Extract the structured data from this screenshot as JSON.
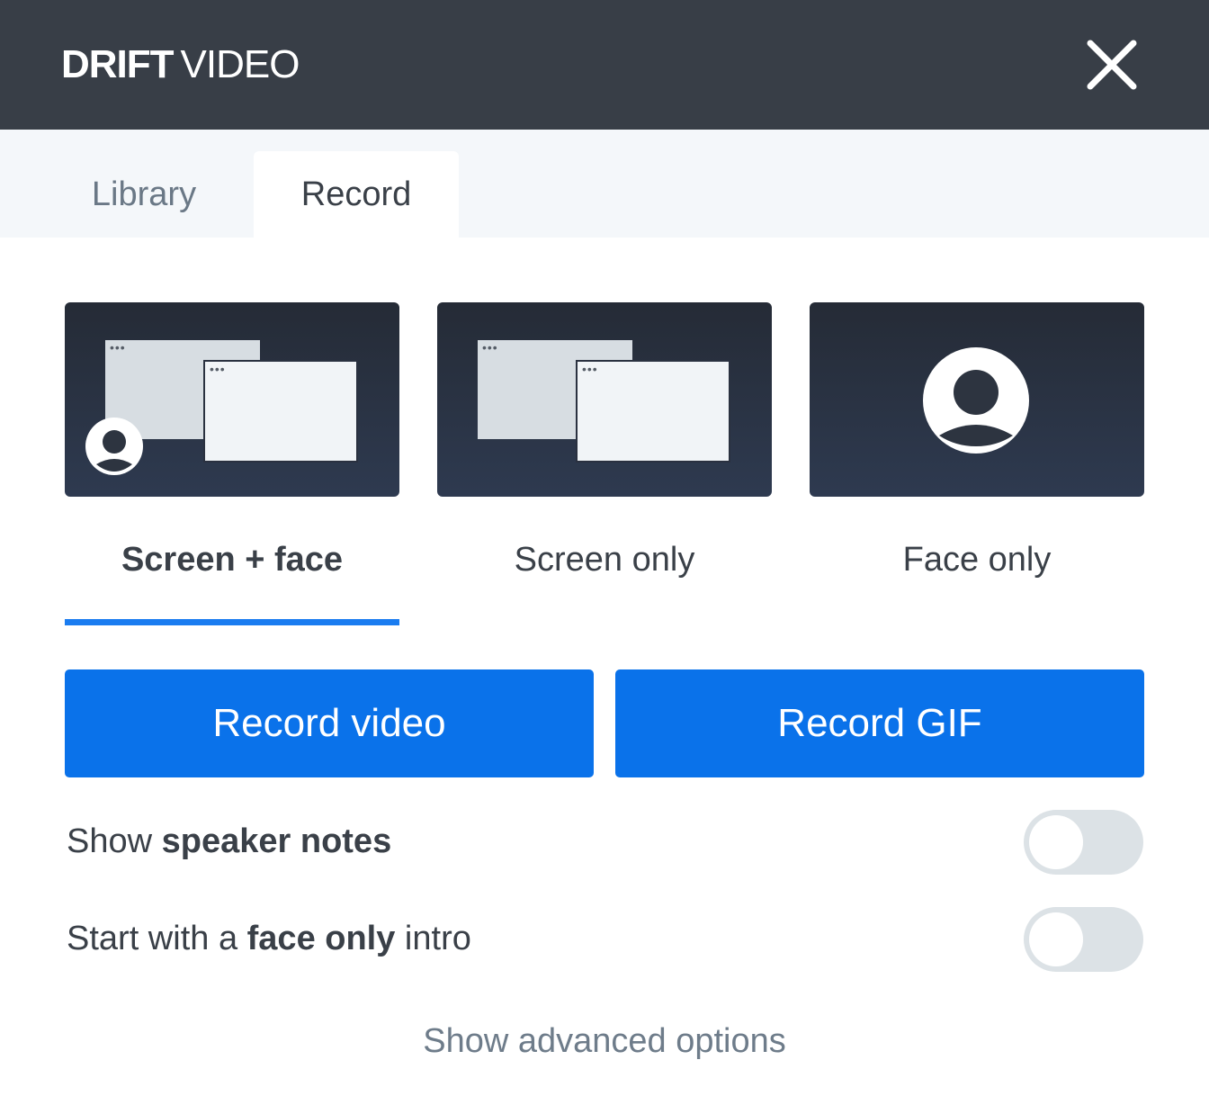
{
  "header": {
    "logo_bold": "DRIFT",
    "logo_light": "VIDEO",
    "close_icon": "close-icon"
  },
  "tabs": [
    {
      "label": "Library",
      "active": false
    },
    {
      "label": "Record",
      "active": true
    }
  ],
  "modes": [
    {
      "label": "Screen + face",
      "selected": true,
      "icon": "screen-face-icon"
    },
    {
      "label": "Screen only",
      "selected": false,
      "icon": "screen-only-icon"
    },
    {
      "label": "Face only",
      "selected": false,
      "icon": "face-only-icon"
    }
  ],
  "window_dots": "•••",
  "actions": {
    "record_video": "Record video",
    "record_gif": "Record GIF"
  },
  "options": {
    "speaker_notes": {
      "prefix": "Show ",
      "bold": "speaker notes",
      "suffix": "",
      "enabled": false
    },
    "face_intro": {
      "prefix": "Start with a ",
      "bold": "face only",
      "suffix": " intro",
      "enabled": false
    }
  },
  "advanced_link": "Show advanced options",
  "colors": {
    "header_bg": "#383e47",
    "accent": "#0a72ea",
    "tabbar_bg": "#f4f7fa",
    "toggle_off": "#dce2e6"
  }
}
